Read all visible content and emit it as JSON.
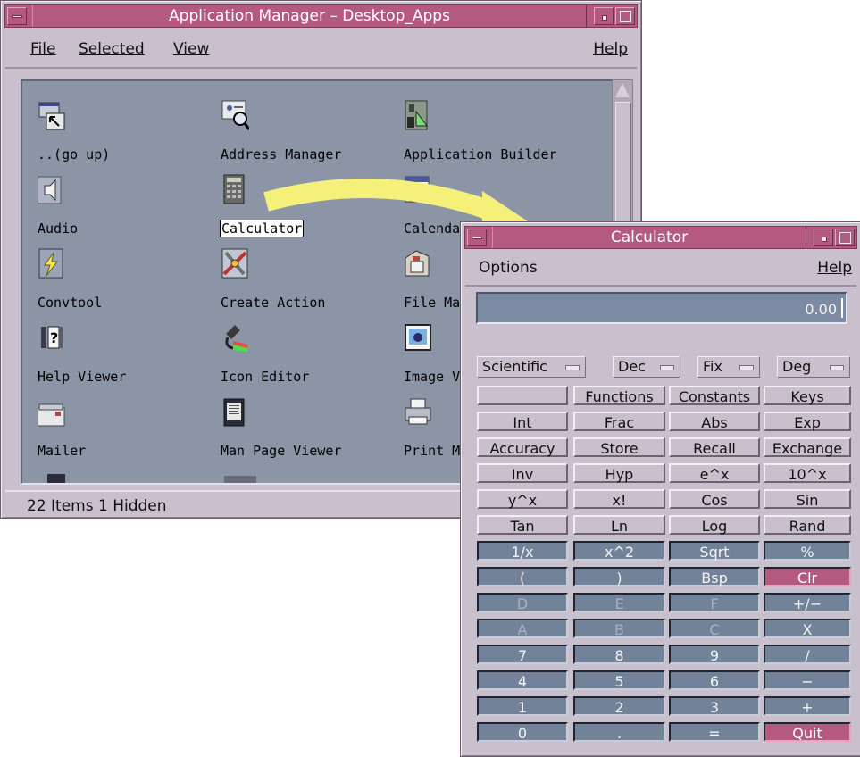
{
  "app_manager": {
    "title": "Application Manager – Desktop_Apps",
    "menus": {
      "file": "File",
      "selected": "Selected",
      "view": "View",
      "help": "Help"
    },
    "items": [
      {
        "label": "..(go up)",
        "icon": "go-up-icon"
      },
      {
        "label": "Address Manager",
        "icon": "address-manager-icon"
      },
      {
        "label": "Application Builder",
        "icon": "application-builder-icon"
      },
      {
        "label": "Audio",
        "icon": "audio-speaker-icon"
      },
      {
        "label": "Calculator",
        "icon": "calculator-icon",
        "selected": true
      },
      {
        "label": "Calendar",
        "icon": "calendar-icon"
      },
      {
        "label": "Convtool",
        "icon": "lightning-icon"
      },
      {
        "label": "Create Action",
        "icon": "create-action-icon"
      },
      {
        "label": "File Manager",
        "icon": "file-manager-icon"
      },
      {
        "label": "Help Viewer",
        "icon": "help-viewer-icon"
      },
      {
        "label": "Icon Editor",
        "icon": "icon-editor-icon"
      },
      {
        "label": "Image Viewer",
        "icon": "image-viewer-icon"
      },
      {
        "label": "Mailer",
        "icon": "mailer-icon"
      },
      {
        "label": "Man Page Viewer",
        "icon": "man-page-viewer-icon"
      },
      {
        "label": "Print Manager",
        "icon": "print-manager-icon"
      }
    ],
    "status": "22 Items 1 Hidden",
    "colors": {
      "titlebar": "#b45a80",
      "window": "#c8c0cc",
      "pane": "#8c95a6"
    }
  },
  "calculator": {
    "title": "Calculator",
    "menus": {
      "options": "Options",
      "help": "Help"
    },
    "display": "0.00",
    "mode_options": [
      "Scientific",
      "Dec",
      "Fix",
      "Deg"
    ],
    "rows": [
      [
        "",
        "Functions",
        "Constants",
        "Keys"
      ],
      [
        "Int",
        "Frac",
        "Abs",
        "Exp"
      ],
      [
        "Accuracy",
        "Store",
        "Recall",
        "Exchange"
      ],
      [
        "Inv",
        "Hyp",
        "e^x",
        "10^x"
      ],
      [
        "y^x",
        "x!",
        "Cos",
        "Sin"
      ],
      [
        "Tan",
        "Ln",
        "Log",
        "Rand"
      ],
      [
        "1/x",
        "x^2",
        "Sqrt",
        "%"
      ],
      [
        "(",
        ")",
        "Bsp",
        "Clr"
      ],
      [
        "D",
        "E",
        "F",
        "+/−"
      ],
      [
        "A",
        "B",
        "C",
        "X"
      ],
      [
        "7",
        "8",
        "9",
        "/"
      ],
      [
        "4",
        "5",
        "6",
        "−"
      ],
      [
        "1",
        "2",
        "3",
        "+"
      ],
      [
        "0",
        ".",
        "=",
        "Quit"
      ]
    ],
    "colors": {
      "keypad": "#728298",
      "accent": "#b45a80"
    }
  },
  "arrow_color": "#f5f07a"
}
